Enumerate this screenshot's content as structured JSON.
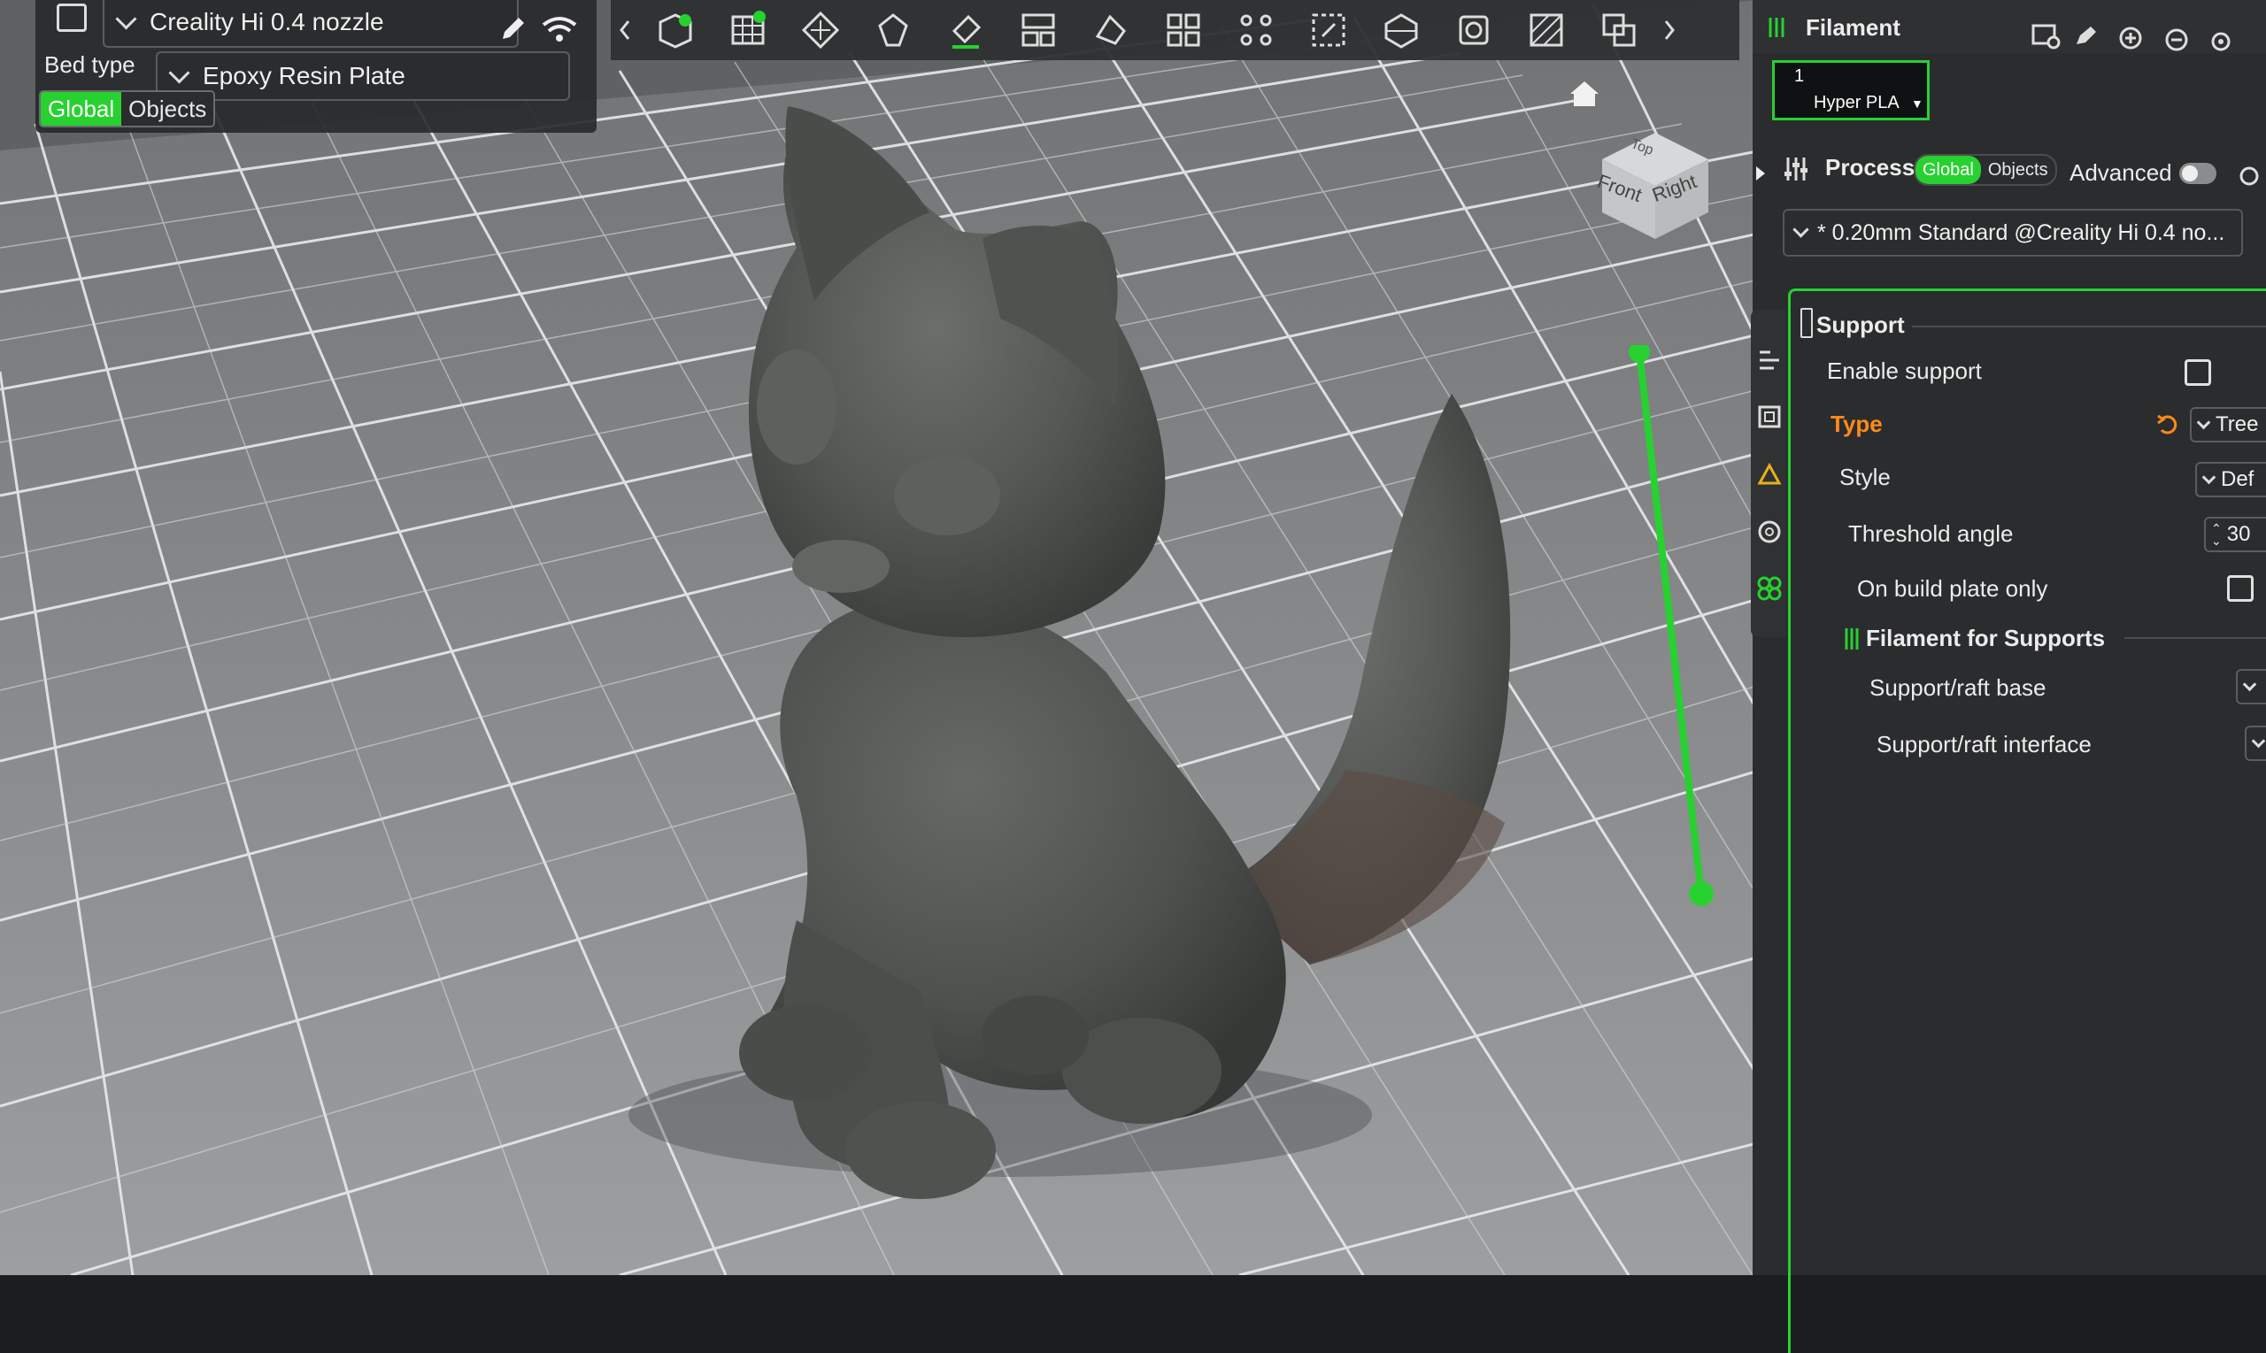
{
  "printer": {
    "name": "Creality Hi 0.4 nozzle",
    "bed_type_label": "Bed type",
    "bed_type_value": "Epoxy Resin Plate",
    "scope_global": "Global",
    "scope_objects": "Objects"
  },
  "view_cube": {
    "top": "Top",
    "front": "Front",
    "right": "Right"
  },
  "filament": {
    "title": "Filament",
    "slot_number": "1",
    "slot_name": "Hyper PLA"
  },
  "process": {
    "title": "Process",
    "scope_global": "Global",
    "scope_objects": "Objects",
    "advanced_label": "Advanced",
    "profile": "* 0.20mm Standard @Creality Hi 0.4 no..."
  },
  "support": {
    "section_title": "Support",
    "enable_support": "Enable support",
    "type_label": "Type",
    "type_value": "Tree",
    "style_label": "Style",
    "style_value": "Def",
    "threshold_label": "Threshold angle",
    "threshold_value": "30",
    "build_plate_only": "On build plate only",
    "filament_section": "Filament for Supports",
    "raft_base": "Support/raft base",
    "raft_interface": "Support/raft interface"
  },
  "colors": {
    "accent": "#27d12f",
    "panel": "#2a2c2e",
    "modified": "#ff8a1c"
  }
}
